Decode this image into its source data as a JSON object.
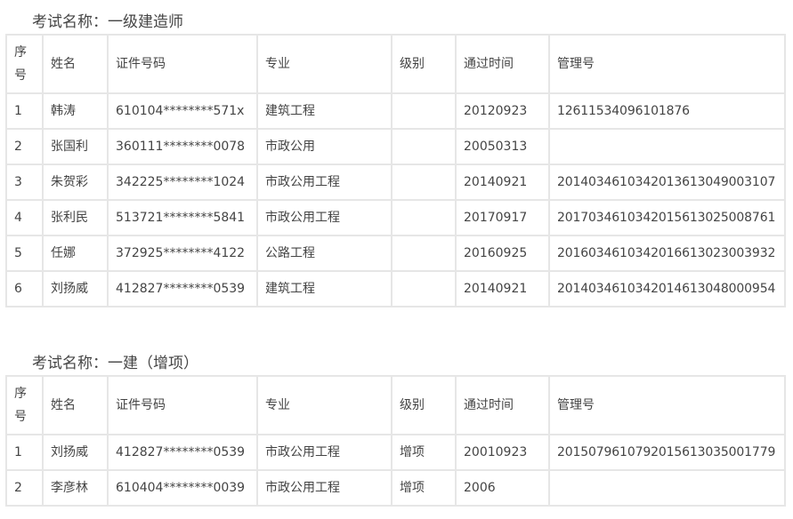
{
  "sections": [
    {
      "title": "考试名称：一级建造师",
      "headers": [
        "序号",
        "姓名",
        "证件号码",
        "专业",
        "级别",
        "通过时间",
        "管理号"
      ],
      "header_seq_line1": "序",
      "header_seq_line2": "号",
      "rows": [
        [
          "1",
          "韩涛",
          "610104********571x",
          "建筑工程",
          "",
          "20120923",
          "12611534096101876"
        ],
        [
          "2",
          "张国利",
          "360111********0078",
          "市政公用",
          "",
          "20050313",
          ""
        ],
        [
          "3",
          "朱贺彩",
          "342225********1024",
          "市政公用工程",
          "",
          "20140921",
          "20140346103420136130490031​07"
        ],
        [
          "4",
          "张利民",
          "513721********5841",
          "市政公用工程",
          "",
          "20170917",
          "201703461034201561302500876​1"
        ],
        [
          "5",
          "任娜",
          "372925********4122",
          "公路工程",
          "",
          "20160925",
          "201603461034201661302300393​2"
        ],
        [
          "6",
          "刘扬威",
          "412827********0539",
          "建筑工程",
          "",
          "20140921",
          "201403461034201461304800095​4"
        ]
      ]
    },
    {
      "title": "考试名称：一建（增项）",
      "headers": [
        "序号",
        "姓名",
        "证件号码",
        "专业",
        "级别",
        "通过时间",
        "管理号"
      ],
      "header_seq_line1": "序",
      "header_seq_line2": "号",
      "rows": [
        [
          "1",
          "刘扬威",
          "412827********0539",
          "市政公用工程",
          "增项",
          "20010923",
          "201507961079201561303500177​9"
        ],
        [
          "2",
          "李彦林",
          "610404********0039",
          "市政公用工程",
          "增项",
          "2006",
          ""
        ]
      ]
    }
  ]
}
